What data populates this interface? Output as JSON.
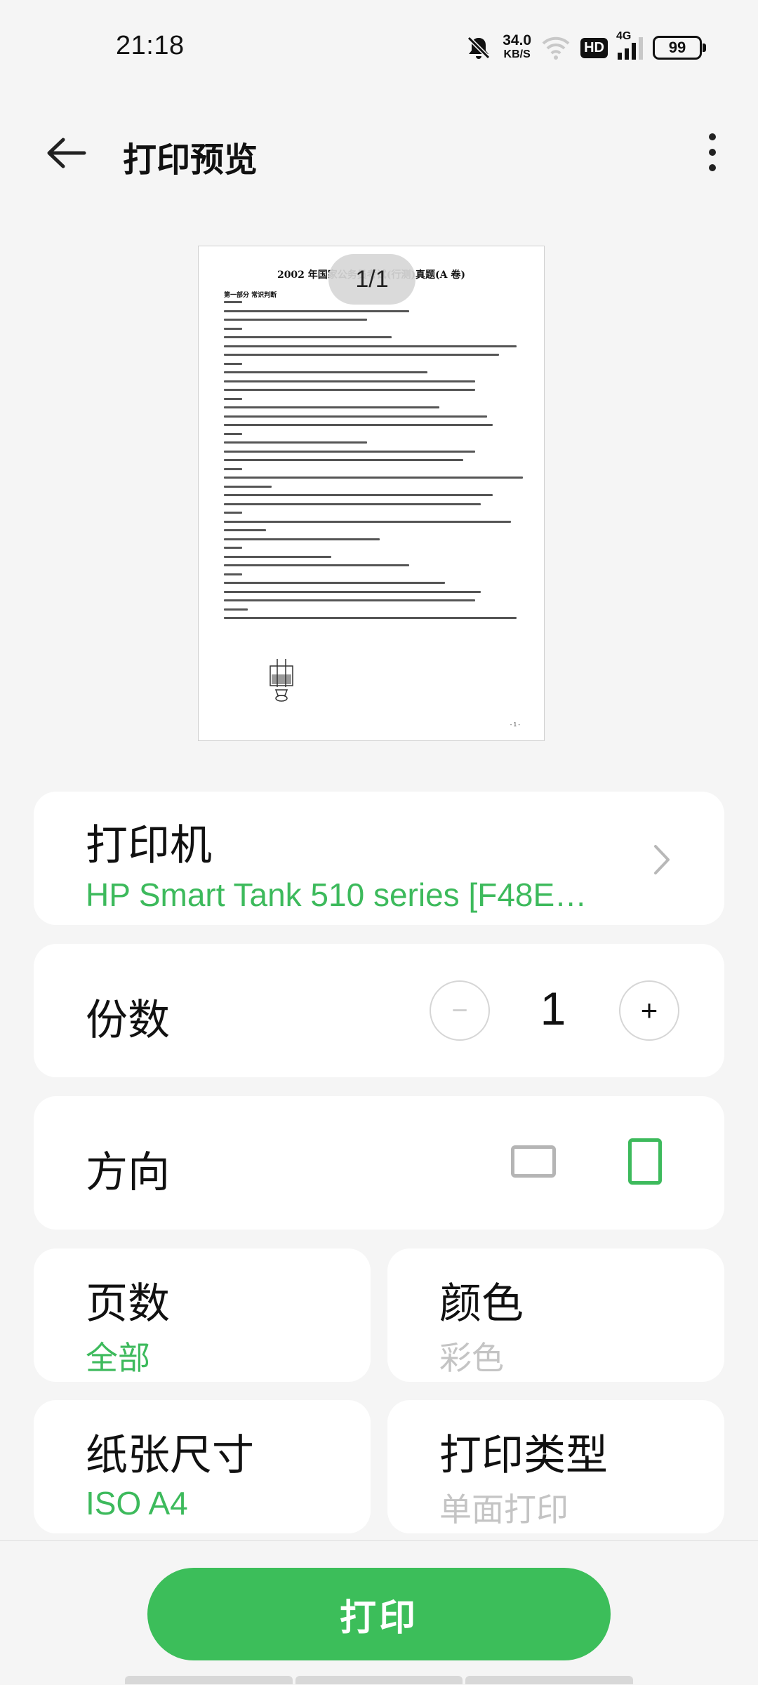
{
  "status_bar": {
    "time": "21:18",
    "net_speed_value": "34.0",
    "net_speed_unit": "KB/S",
    "hd": "HD",
    "network": "4G",
    "battery": "99"
  },
  "header": {
    "title": "打印预览"
  },
  "preview": {
    "page_indicator": "1/1",
    "doc_title": "2002 年国家公务员考试(行测)真题(A 卷)",
    "doc_section": "第一部分 常识判断",
    "doc_page_footer": "- 1 -"
  },
  "printer": {
    "label": "打印机",
    "value": "HP Smart Tank 510 series [F48E…"
  },
  "copies": {
    "label": "份数",
    "value": "1",
    "minus": "−",
    "plus": "+"
  },
  "orientation": {
    "label": "方向",
    "selected": "portrait"
  },
  "pages": {
    "label": "页数",
    "value": "全部"
  },
  "color": {
    "label": "颜色",
    "value": "彩色"
  },
  "paper_size": {
    "label": "纸张尺寸",
    "value": "ISO A4"
  },
  "print_type": {
    "label": "打印类型",
    "value": "单面打印"
  },
  "actions": {
    "print": "打印"
  },
  "colors": {
    "accent": "#3dba5c",
    "background": "#f5f5f5",
    "card": "#ffffff",
    "disabled": "#c4c4c4"
  }
}
